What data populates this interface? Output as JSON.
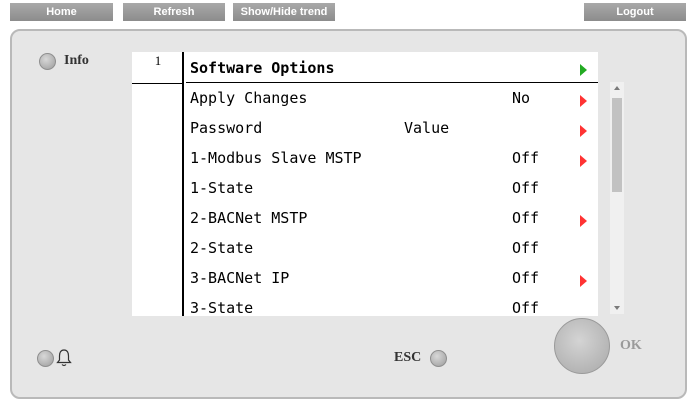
{
  "toolbar": {
    "home": "Home",
    "refresh": "Refresh",
    "show_hide_trend": "Show/Hide trend",
    "logout": "Logout"
  },
  "panel": {
    "info_label": "Info",
    "esc_label": "ESC",
    "ok_label": "OK"
  },
  "screen": {
    "index": "1",
    "title": "Software Options",
    "rows": [
      {
        "label": "Apply Changes",
        "value": "No",
        "arrow": true
      },
      {
        "label": "Password",
        "value": "Value",
        "arrow": true
      },
      {
        "label": "1-Modbus Slave MSTP",
        "value": "Off",
        "arrow": true
      },
      {
        "label": "1-State",
        "value": "Off",
        "arrow": false
      },
      {
        "label": "2-BACNet MSTP",
        "value": "Off",
        "arrow": true
      },
      {
        "label": "2-State",
        "value": "Off",
        "arrow": false
      },
      {
        "label": "3-BACNet IP",
        "value": "Off",
        "arrow": true
      },
      {
        "label": "3-State",
        "value": "Off",
        "arrow": false
      }
    ]
  },
  "colors": {
    "arrow_red": "#ff3333",
    "arrow_green": "#22aa22",
    "panel_bg": "#e6e6e6",
    "toolbar_bg": "#9c9c9c"
  }
}
